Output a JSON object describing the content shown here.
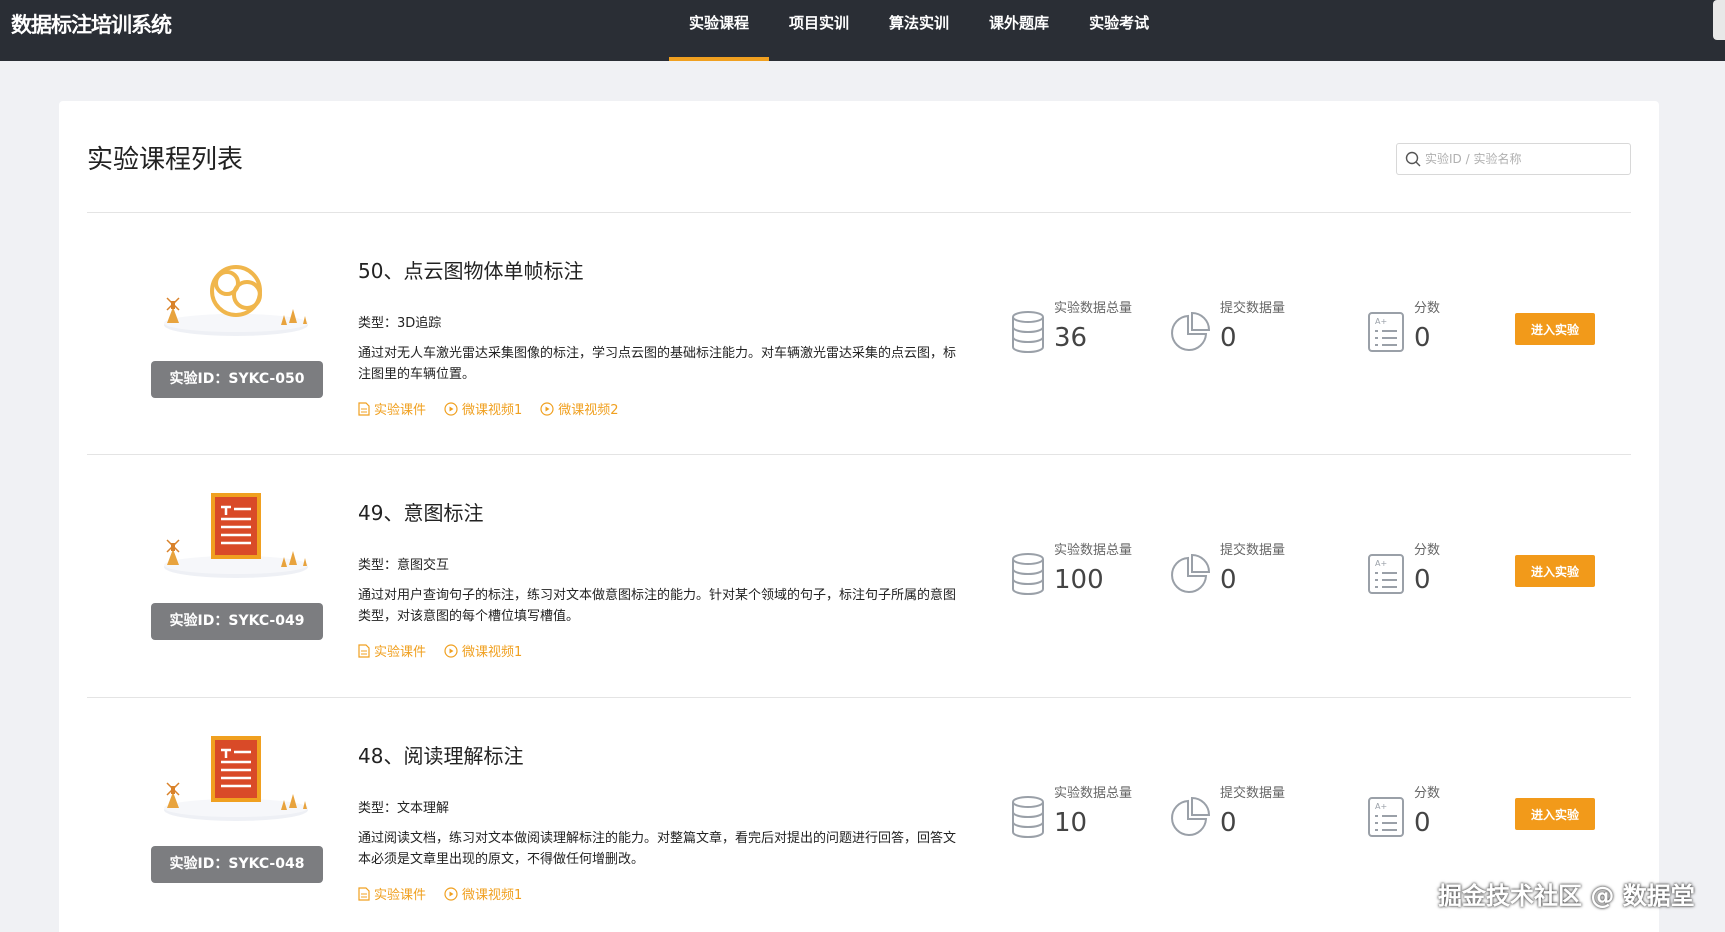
{
  "brand": "数据标注培训系统",
  "nav": [
    {
      "label": "实验课程",
      "active": true
    },
    {
      "label": "项目实训",
      "active": false
    },
    {
      "label": "算法实训",
      "active": false
    },
    {
      "label": "课外题库",
      "active": false
    },
    {
      "label": "实验考试",
      "active": false
    }
  ],
  "page": {
    "title": "实验课程列表",
    "search_placeholder": "实验ID / 实验名称"
  },
  "stat_labels": {
    "total": "实验数据总量",
    "submitted": "提交数据量",
    "score": "分数"
  },
  "enter_button": "进入实验",
  "courses": [
    {
      "title": "50、点云图物体单帧标注",
      "type": "类型：3D追踪",
      "desc": "通过对无人车激光雷达采集图像的标注，学习点云图的基础标注能力。对车辆激光雷达采集的点云图，标注图里的车辆位置。",
      "id_label": "实验ID：SYKC-050",
      "thumb": "cloud-icon",
      "links": [
        "实验课件",
        "微课视频1",
        "微课视频2"
      ],
      "total": "36",
      "submitted": "0",
      "score": "0"
    },
    {
      "title": "49、意图标注",
      "type": "类型：意图交互",
      "desc": "通过对用户查询句子的标注，练习对文本做意图标注的能力。针对某个领域的句子，标注句子所属的意图类型，对该意图的每个槽位填写槽值。",
      "id_label": "实验ID：SYKC-049",
      "thumb": "document-icon",
      "links": [
        "实验课件",
        "微课视频1"
      ],
      "total": "100",
      "submitted": "0",
      "score": "0"
    },
    {
      "title": "48、阅读理解标注",
      "type": "类型：文本理解",
      "desc": "通过阅读文档，练习对文本做阅读理解标注的能力。对整篇文章，看完后对提出的问题进行回答，回答文本必须是文章里出现的原文，不得做任何增删改。",
      "id_label": "实验ID：SYKC-048",
      "thumb": "document-icon",
      "links": [
        "实验课件",
        "微课视频1"
      ],
      "total": "10",
      "submitted": "0",
      "score": "0"
    }
  ],
  "watermark": "掘金技术社区 @ 数据堂",
  "colors": {
    "topbar": "#2a2e35",
    "accent": "#f0a020",
    "button": "#f29a1a",
    "badge": "#7c7d80"
  }
}
